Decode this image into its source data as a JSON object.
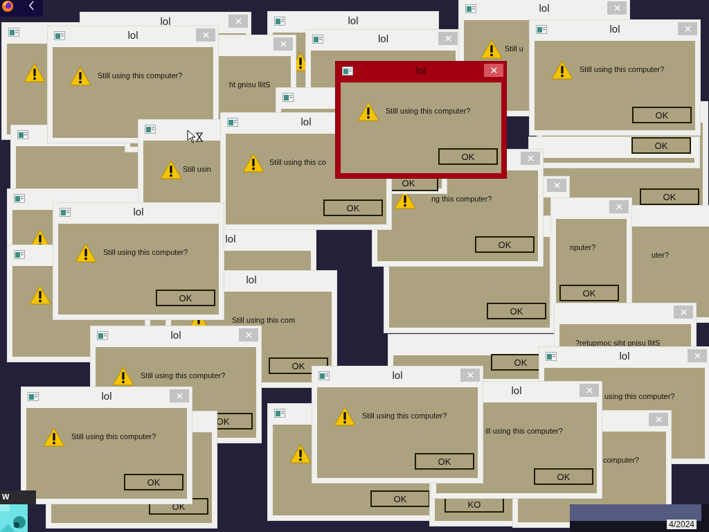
{
  "windows": [
    {
      "icon": true,
      "warning": true,
      "active": false
    },
    {
      "icon": true,
      "active": false
    },
    {
      "icon": true,
      "warning": true,
      "active": false
    },
    {
      "icon": true,
      "warning": true,
      "active": false
    },
    {
      "title": "lol",
      "close": true,
      "active": false
    },
    {
      "icon": true,
      "title": "lol",
      "warning": true,
      "active": false
    },
    {
      "icon": true,
      "title": "lol",
      "close": true,
      "active": false
    },
    {
      "icon": true,
      "title": "lol",
      "close": true,
      "warning": true,
      "message": "Still u",
      "active": false
    },
    {
      "close": true,
      "message": "ht gnisu llitS",
      "active": false
    },
    {
      "icon": true,
      "title": "lol",
      "close": true,
      "warning": true,
      "message": "Still using this computer?",
      "active": false
    },
    {
      "ok": "OK",
      "active": false
    },
    {
      "icon": true,
      "title": "lol",
      "close": true,
      "warning": true,
      "message": "Still using this computer?",
      "ok": "OK",
      "active": false
    },
    {
      "ok": "OK",
      "active": false
    },
    {
      "close": true,
      "active": false
    },
    {
      "ok": "OK",
      "active": false
    },
    {
      "ok": "OK",
      "active": false
    },
    {
      "message": "uter?",
      "active": false
    },
    {
      "close": true,
      "message": "nputer?",
      "ok": "OK",
      "active": false
    },
    {
      "close": true,
      "message": "?retupmoc siht gnisu llitS",
      "active": false
    },
    {
      "close": true,
      "warning": true,
      "message": "ng this computer?",
      "ok": "OK",
      "active": false
    },
    {
      "icon": true,
      "ok": "OK",
      "active": false
    },
    {
      "icon": true,
      "warning": true,
      "message": "Still usin",
      "active": false
    },
    {
      "icon": true,
      "title": "lol",
      "warning": true,
      "message": "Still using this co",
      "ok": "OK",
      "active": false
    },
    {
      "title": "lol",
      "active": false
    },
    {
      "title": "lol",
      "warning": true,
      "message": "Still using this com",
      "ok": "OK",
      "active": false
    },
    {
      "icon": true,
      "title": "lol",
      "warning": true,
      "message": "Still using this computer?",
      "ok": "OK",
      "active": false
    },
    {
      "icon": true,
      "title": "lol",
      "close": true,
      "warning": true,
      "message": "Still using this computer?",
      "ok": "OK",
      "active": false
    },
    {
      "ok": "OK",
      "active": false
    },
    {
      "icon": true,
      "title": "lol",
      "close": true,
      "warning": true,
      "message": "Still using this computer?",
      "ok": "OK",
      "active": false
    },
    {
      "icon": true,
      "warning": true,
      "ok": "OK",
      "active": false
    },
    {
      "ok": "KO",
      "active": false
    },
    {
      "icon": true,
      "title": "lol",
      "close": true,
      "message": "using this computer?",
      "active": false
    },
    {
      "close": true,
      "message": "computer?",
      "active": false
    },
    {
      "title": "lol",
      "close": true,
      "message": "ill using this computer?",
      "ok": "OK",
      "active": false
    },
    {
      "icon": true,
      "title": "lol",
      "close": true,
      "warning": true,
      "message": "Still using this computer?",
      "ok": "OK",
      "active": false
    },
    {
      "icon": true,
      "title": "lol",
      "close": true,
      "warning": true,
      "message": "Still using this computer?",
      "ok": "OK",
      "active": true
    }
  ],
  "corner_label": "W",
  "taskbar": {
    "date": "4/2024"
  }
}
